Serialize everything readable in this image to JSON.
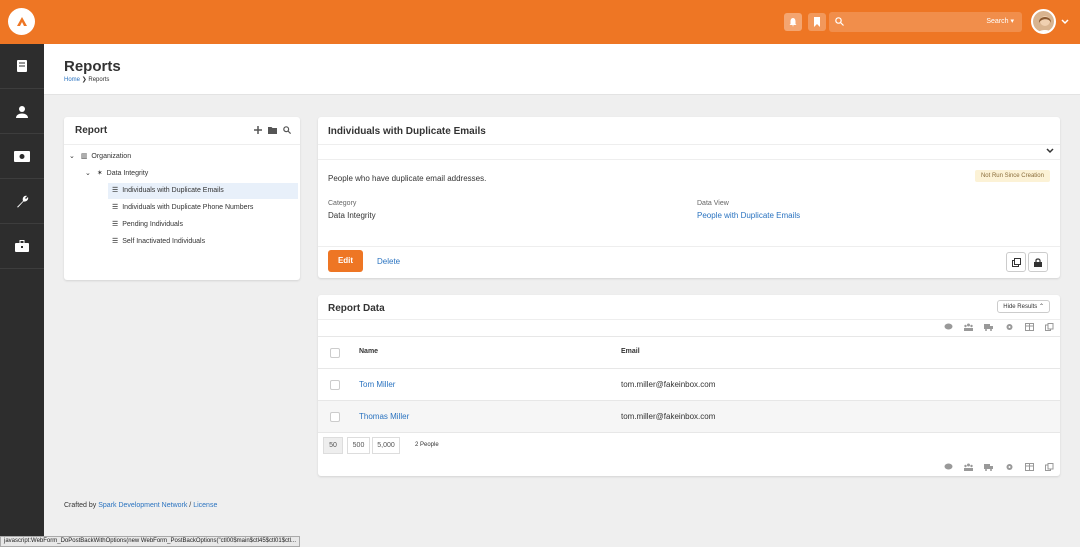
{
  "topbar": {
    "search_placeholder": "Search",
    "search_dropdown": "Search ▾",
    "accent": "#ee7624"
  },
  "sidebar": {
    "items": [
      {
        "icon": "book-icon"
      },
      {
        "icon": "person-icon"
      },
      {
        "icon": "money-icon"
      },
      {
        "icon": "wrench-icon"
      },
      {
        "icon": "briefcase-icon"
      }
    ]
  },
  "page": {
    "title": "Reports",
    "breadcrumb": [
      "Home",
      "Reports"
    ]
  },
  "tree": {
    "title": "Report",
    "root": "Organization",
    "category": "Data Integrity",
    "items": [
      "Individuals with Duplicate Emails",
      "Individuals with Duplicate Phone Numbers",
      "Pending Individuals",
      "Self Inactivated Individuals"
    ]
  },
  "detail": {
    "title": "Individuals with Duplicate Emails",
    "description": "People who have duplicate email addresses.",
    "badge": "Not Run Since Creation",
    "category_label": "Category",
    "category_value": "Data Integrity",
    "dataview_label": "Data View",
    "dataview_value": "People with Duplicate Emails",
    "edit_label": "Edit",
    "delete_label": "Delete"
  },
  "report_data": {
    "title": "Report Data",
    "hide_results": "Hide Results ⌃",
    "columns": [
      "Name",
      "Email"
    ],
    "rows": [
      {
        "name": "Tom Miller",
        "email": "tom.miller@fakeinbox.com"
      },
      {
        "name": "Thomas Miller",
        "email": "tom.miller@fakeinbox.com"
      }
    ],
    "page_sizes": [
      "50",
      "500",
      "5,000"
    ],
    "count": "2 People"
  },
  "footer": {
    "crafted_by": "Crafted by",
    "link1": "Spark Development Network",
    "sep": "/",
    "link2": "License"
  },
  "statusbar": "javascript:WebForm_DoPostBackWithOptions(new WebForm_PostBackOptions(\"ctl00$main$ctl45$ctl01$ctl..."
}
